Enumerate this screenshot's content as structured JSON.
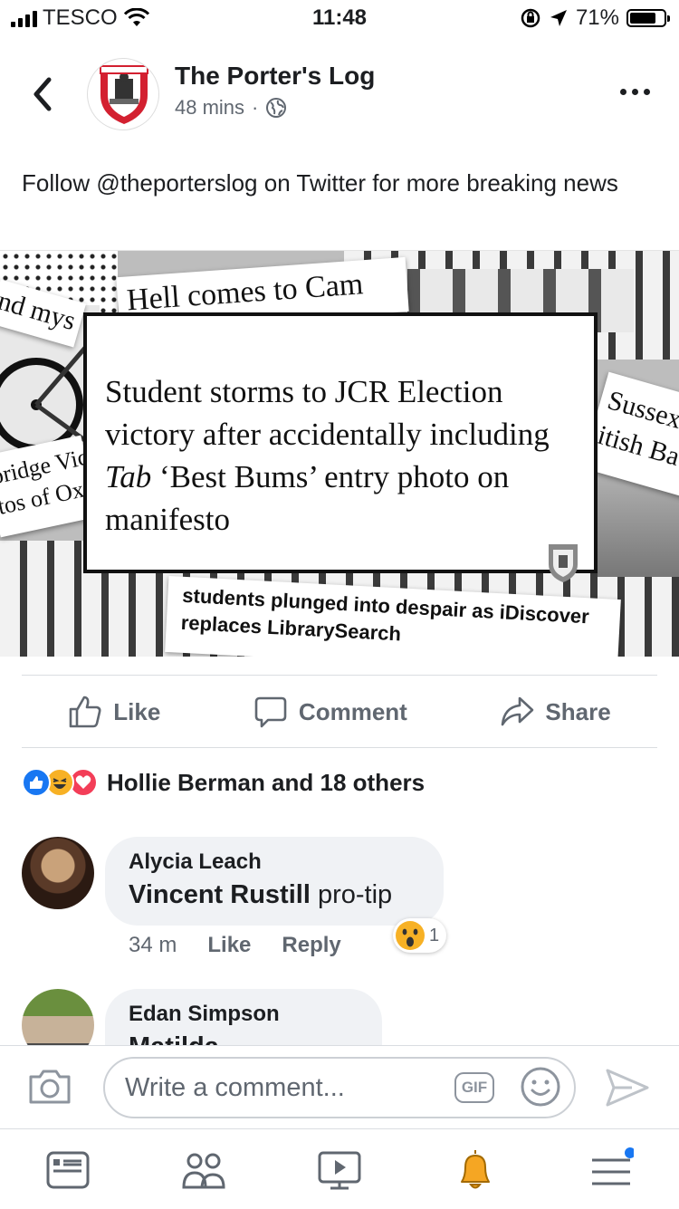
{
  "status_bar": {
    "carrier": "TESCO",
    "time": "11:48",
    "battery_percent": "71%"
  },
  "post": {
    "page_name": "The Porter's Log",
    "time_ago": "48 mins",
    "separator": "·",
    "text": "Follow @theporterslog on Twitter for more breaking news",
    "image": {
      "headline_part1": "Student storms to JCR Election victory after accidentally including ",
      "headline_italic": "Tab",
      "headline_part2": " ‘Best Bums’ entry photo on manifesto",
      "clippings": {
        "top": "Hell comes to Cam",
        "left_top": "nd mys",
        "left_mid_1": "bridge Vice",
        "left_mid_2": "tos of Oxfo",
        "right_1": "Sussex",
        "right_2": "itish Ba",
        "bottom_1": "students plunged into despair as iDiscover",
        "bottom_2": "replaces LibrarySearch"
      }
    },
    "actions": {
      "like": "Like",
      "comment": "Comment",
      "share": "Share"
    },
    "reactions_text": "Hollie Berman and 18 others"
  },
  "comments": [
    {
      "author": "Alycia Leach",
      "tag": "Vincent Rustill",
      "text": " pro-tip",
      "time": "34 m",
      "like": "Like",
      "reply": "Reply",
      "reaction_count": "1"
    },
    {
      "author": "Edan Simpson",
      "tag": "Matilda Colemefield",
      "text": ""
    }
  ],
  "composer": {
    "placeholder": "Write a comment...",
    "gif_label": "GIF"
  },
  "colors": {
    "facebook_blue": "#1877f2",
    "haha_yellow": "#f7b125",
    "love_red": "#f33e58",
    "notification_gold": "#f5a623"
  }
}
